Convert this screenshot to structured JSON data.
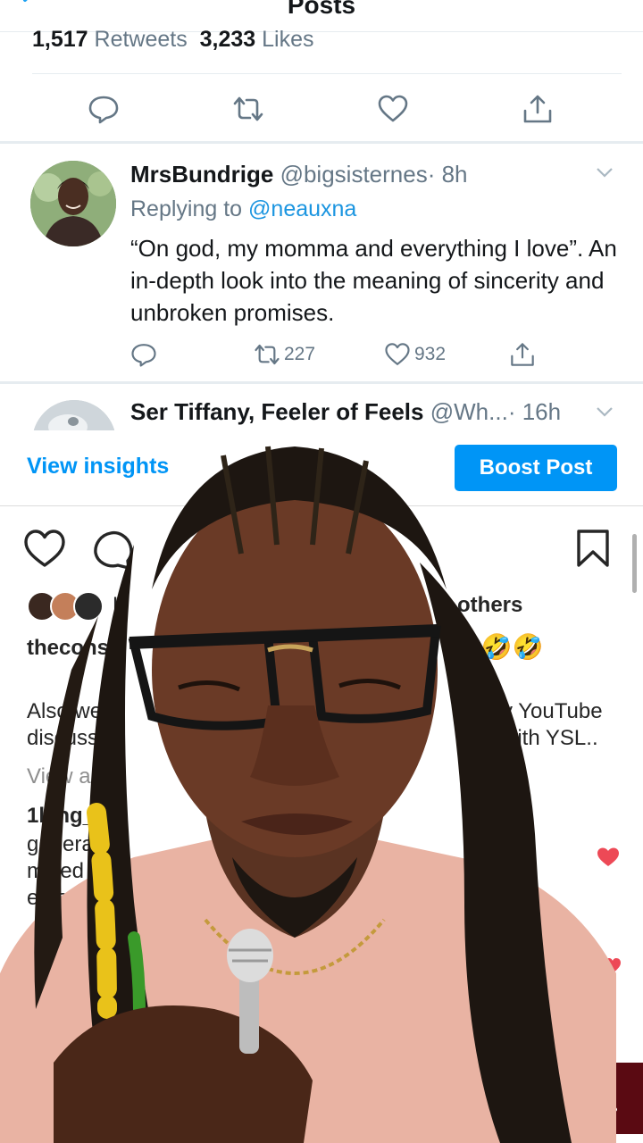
{
  "twitter": {
    "header_title": "Posts",
    "retweets_count": "1,517",
    "retweets_label": "Retweets",
    "likes_count": "3,233",
    "likes_label": "Likes",
    "reply": {
      "name": "MrsBundrige",
      "handle": "@bigsisternes",
      "time": "· 8h",
      "replying_label": "Replying to",
      "replying_handle": "@neauxna",
      "text": "“On god, my momma and everything I love”. An in-depth look into the meaning of sincerity and unbroken promises.",
      "retweets": "227",
      "likes": "932"
    },
    "reply2": {
      "name": "Ser Tiffany, Feeler of Feels",
      "handle": "@Wh...",
      "time": "· 16h"
    }
  },
  "instagram": {
    "view_insights": "View insights",
    "boost_post": "Boost Post",
    "liked_by_partial": "L",
    "others": "others",
    "caption_user": "thecons",
    "caption_emoji": "😂🤣🤣",
    "caption_left_lines": [
      "Also we",
      "discussi"
    ],
    "caption_right_lines": [
      "my YouTube",
      "with YSL.."
    ],
    "view_all": "View all",
    "comment_user": "1king_n",
    "comment_lines": [
      "generat",
      "mised",
      "enfo"
    ]
  },
  "colors": {
    "twitter_link": "#1b95e0",
    "twitter_gray": "#657786",
    "instagram_blue": "#0095f6",
    "like_red": "#ed4956"
  }
}
